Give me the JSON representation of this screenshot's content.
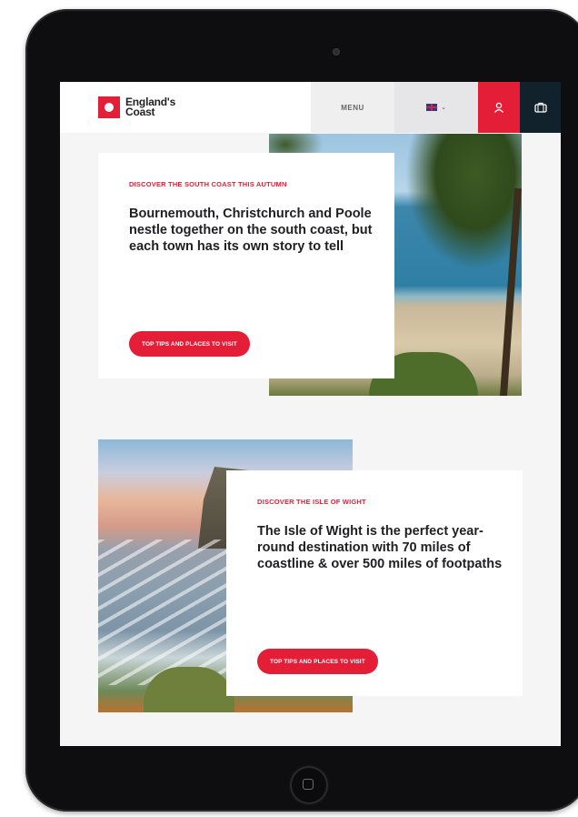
{
  "header": {
    "logo_line1": "England's",
    "logo_line2": "Coast",
    "menu_label": "MENU",
    "language_chevron": "⌄",
    "icons": [
      "logo-icon",
      "uk-flag-icon",
      "user-icon",
      "suitcase-icon"
    ]
  },
  "sections": [
    {
      "eyebrow": "DISCOVER THE SOUTH COAST THIS AUTUMN",
      "heading": "Bournemouth, Christchurch and Poole nestle together on the south coast, but each town has its own story to tell",
      "cta": "TOP TIPS AND PLACES TO VISIT"
    },
    {
      "eyebrow": "DISCOVER THE ISLE OF WIGHT",
      "heading": "The Isle of Wight is the perfect year-round destination with 70 miles of coastline & over 500 miles of footpaths",
      "cta": "TOP TIPS AND PLACES TO VISIT"
    }
  ],
  "colors": {
    "brand_red": "#e41e37",
    "navy": "#12222c",
    "page_bg": "#f5f5f6"
  }
}
